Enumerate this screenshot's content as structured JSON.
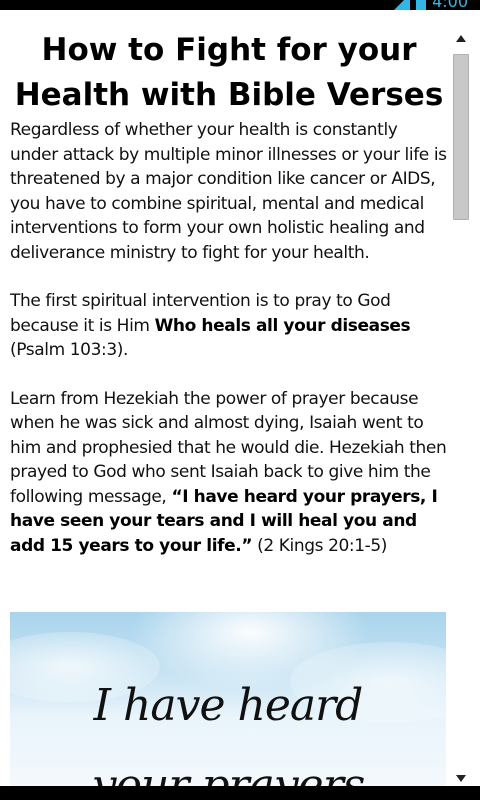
{
  "status_bar": {
    "time": "4:00",
    "icons": [
      "signal-icon",
      "battery-icon"
    ],
    "accent_color": "#33b5e5"
  },
  "article": {
    "title": "How to Fight for your Health with Bible Verses",
    "p1": "Regardless of whether your health is constantly under attack by multiple minor illnesses or your life is threatened by a major condition like cancer or AIDS, you have to combine spiritual, mental and medical interventions to form your own holistic healing and deliverance ministry to fight for your health.",
    "p2_start": "The first spiritual intervention is to pray to God because it is Him ",
    "p2_bold": "Who heals all your diseases",
    "p2_end": " (Psalm 103:3).",
    "p3_start": "Learn from Hezekiah the power of prayer because when he was sick and almost dying, Isaiah went to him and prophesied that he would die. Hezekiah then prayed to God who sent Isaiah back to give him the following message, ",
    "p3_bold": "“I have heard your prayers, I have seen your tears and I will heal you and add 15 years to your life.”",
    "p3_end": " (2 Kings 20:1-5)"
  },
  "image": {
    "line1": "I have heard",
    "line2": "your prayers"
  },
  "scrollbar": {
    "up_icon": "chevron-up-icon",
    "down_icon": "chevron-down-icon",
    "position": 0.0
  }
}
